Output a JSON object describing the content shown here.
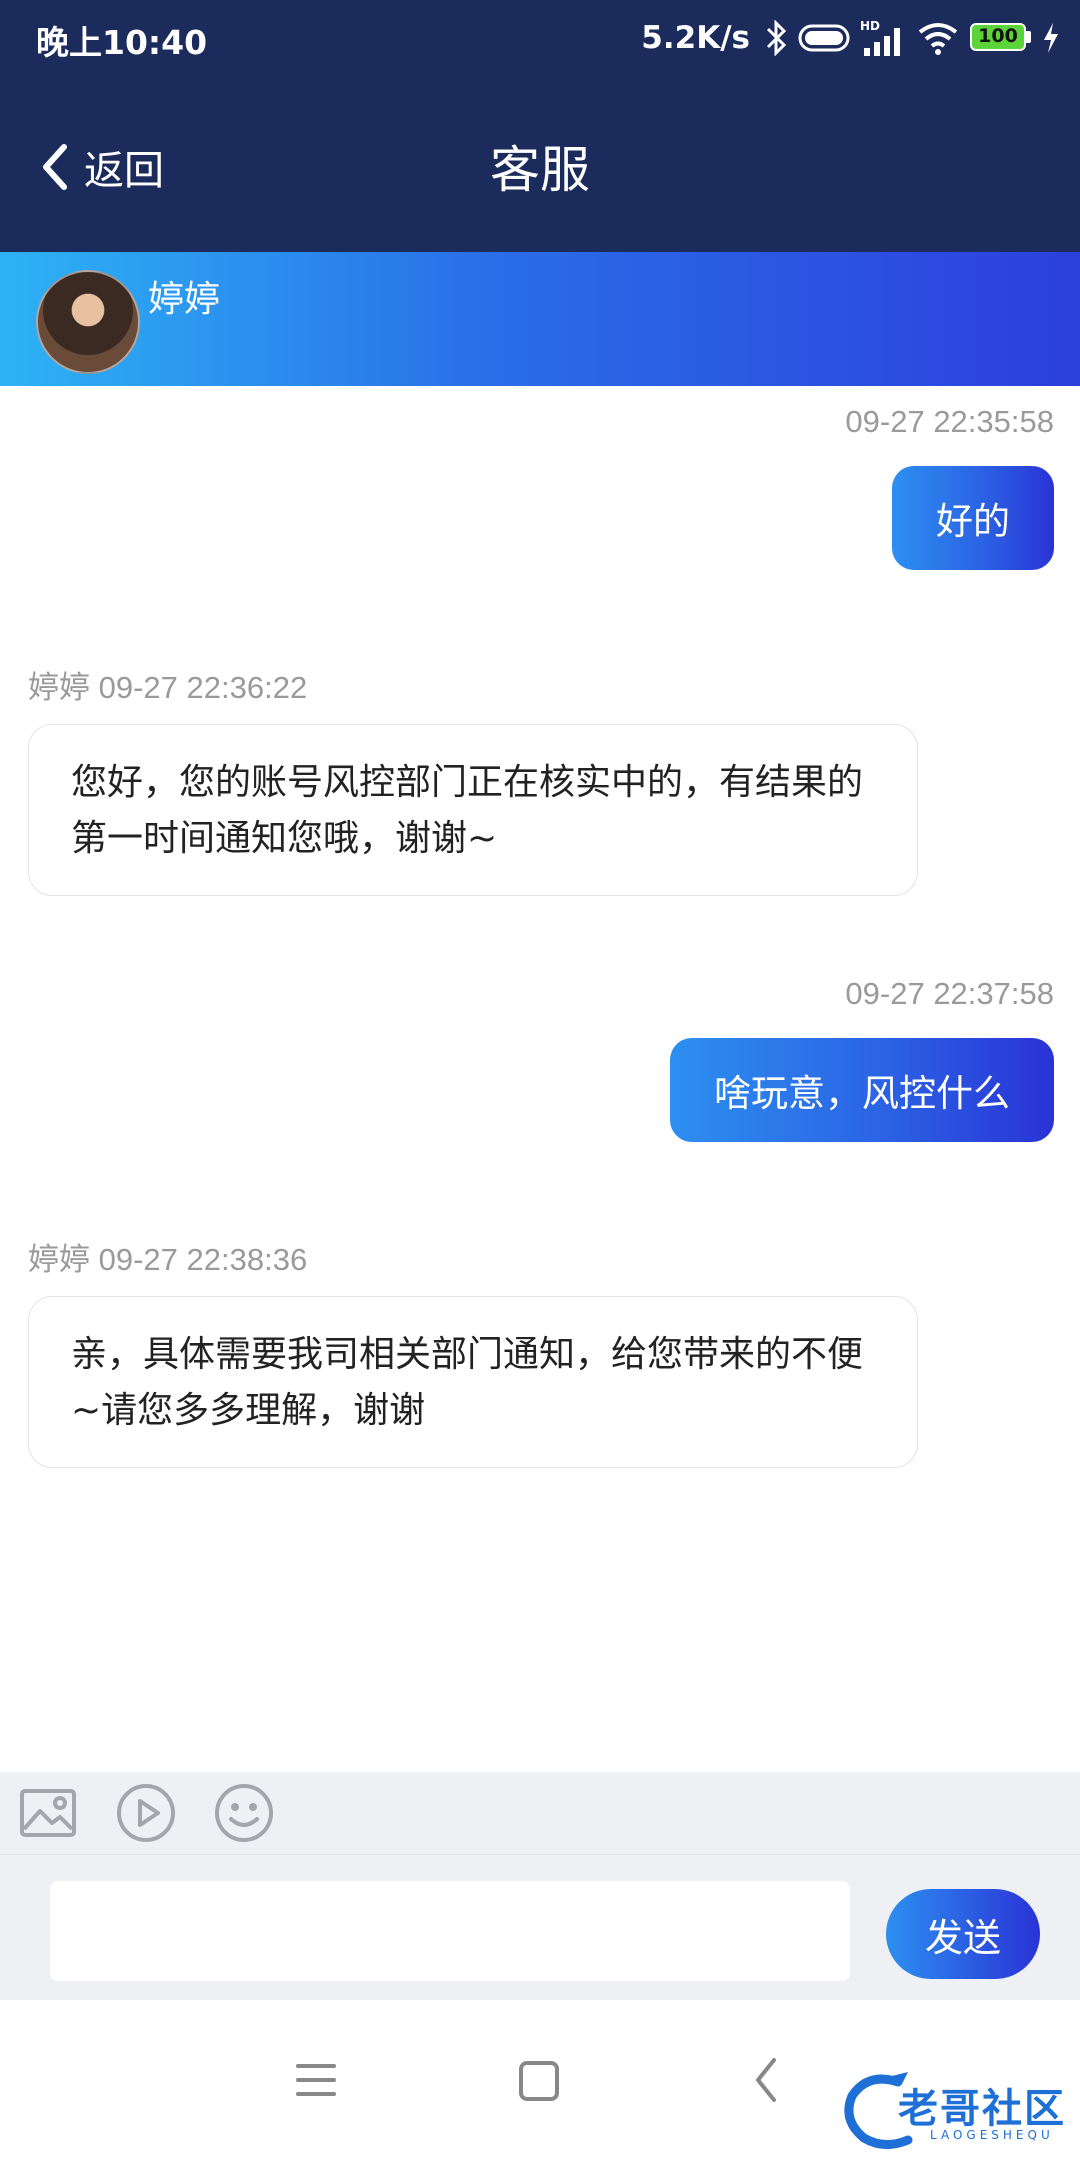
{
  "status_bar": {
    "time": "晚上10:40",
    "net_speed": "5.2K/s",
    "battery": "100"
  },
  "header": {
    "back_label": "返回",
    "title": "客服"
  },
  "agent": {
    "name": "婷婷"
  },
  "messages": [
    {
      "direction": "out",
      "timestamp": "09-27 22:35:58",
      "text": "好的"
    },
    {
      "direction": "in",
      "sender": "婷婷",
      "timestamp": "09-27 22:36:22",
      "text": "您好，您的账号风控部门正在核实中的，有结果的第一时间通知您哦，谢谢~"
    },
    {
      "direction": "out",
      "timestamp": "09-27 22:37:58",
      "text": "啥玩意，风控什么"
    },
    {
      "direction": "in",
      "sender": "婷婷",
      "timestamp": "09-27 22:38:36",
      "text": "亲，具体需要我司相关部门通知，给您带来的不便~请您多多理解，谢谢"
    }
  ],
  "composer": {
    "input_value": "",
    "send_label": "发送"
  },
  "watermark": {
    "text": "老哥社区",
    "sub": "LAOGESHEQU"
  },
  "colors": {
    "header_bg": "#1b2b5c",
    "accent_start": "#2d8ff0",
    "accent_end": "#2a33d6",
    "timestamp": "#9a9a9a"
  }
}
